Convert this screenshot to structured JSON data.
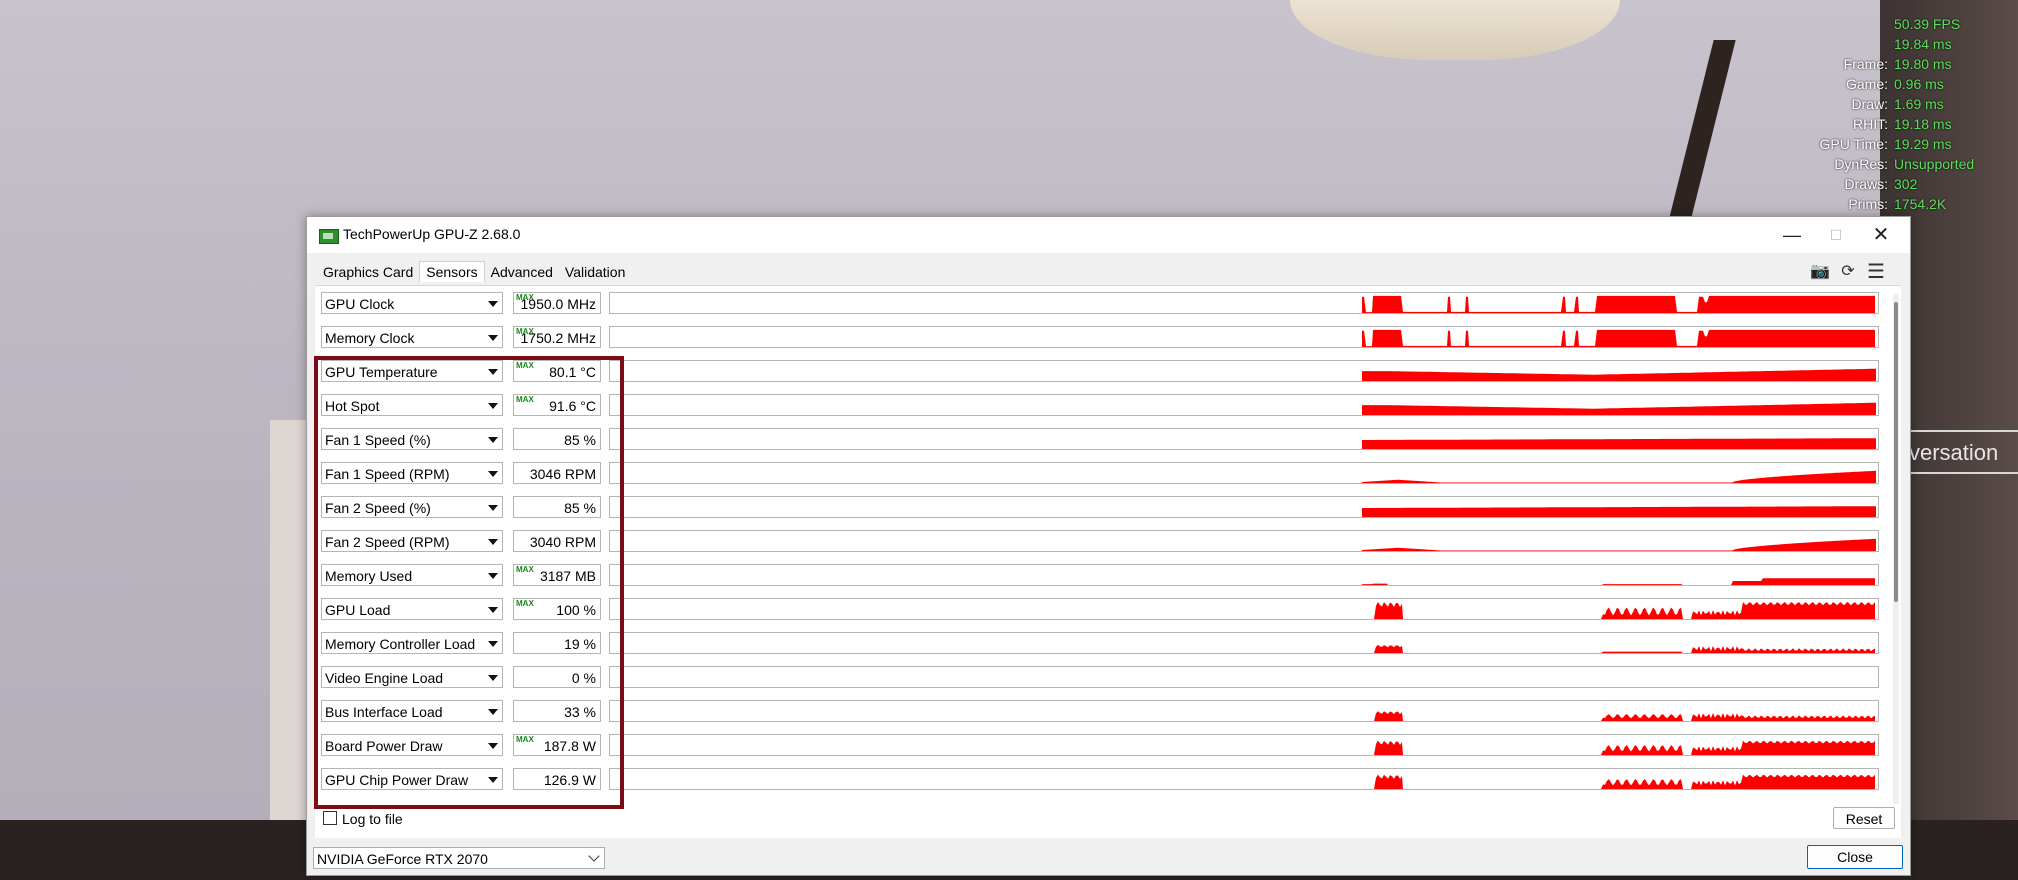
{
  "overlay_stats": [
    {
      "label": "",
      "value": "50.39 FPS"
    },
    {
      "label": "",
      "value": "19.84 ms"
    },
    {
      "label": "Frame:",
      "value": "19.80 ms"
    },
    {
      "label": "Game:",
      "value": "0.96 ms"
    },
    {
      "label": "Draw:",
      "value": "1.69 ms"
    },
    {
      "label": "RHIT:",
      "value": "19.18 ms"
    },
    {
      "label": "GPU Time:",
      "value": "19.29 ms"
    },
    {
      "label": "DynRes:",
      "value": "Unsupported"
    },
    {
      "label": "Draws:",
      "value": "302"
    },
    {
      "label": "Prims:",
      "value": "1754.2K"
    }
  ],
  "background": {
    "partial_text": "versation"
  },
  "window": {
    "title": "TechPowerUp GPU-Z 2.68.0",
    "tabs": [
      "Graphics Card",
      "Sensors",
      "Advanced",
      "Validation"
    ],
    "active_tab": "Sensors",
    "sensors": [
      {
        "name": "GPU Clock",
        "value": "1950.0 MHz",
        "max": true,
        "graph": "clock"
      },
      {
        "name": "Memory Clock",
        "value": "1750.2 MHz",
        "max": true,
        "graph": "clock"
      },
      {
        "name": "GPU Temperature",
        "value": "80.1 °C",
        "max": true,
        "graph": "temp"
      },
      {
        "name": "Hot Spot",
        "value": "91.6 °C",
        "max": true,
        "graph": "temp"
      },
      {
        "name": "Fan 1 Speed (%)",
        "value": "85 %",
        "max": false,
        "graph": "fanpct"
      },
      {
        "name": "Fan 1 Speed (RPM)",
        "value": "3046 RPM",
        "max": false,
        "graph": "fanrpm"
      },
      {
        "name": "Fan 2 Speed (%)",
        "value": "85 %",
        "max": false,
        "graph": "fanpct"
      },
      {
        "name": "Fan 2 Speed (RPM)",
        "value": "3040 RPM",
        "max": false,
        "graph": "fanrpm"
      },
      {
        "name": "Memory Used",
        "value": "3187 MB",
        "max": true,
        "graph": "mem"
      },
      {
        "name": "GPU Load",
        "value": "100 %",
        "max": true,
        "graph": "load"
      },
      {
        "name": "Memory Controller Load",
        "value": "19 %",
        "max": false,
        "graph": "mcload"
      },
      {
        "name": "Video Engine Load",
        "value": "0 %",
        "max": false,
        "graph": "none"
      },
      {
        "name": "Bus Interface Load",
        "value": "33 %",
        "max": false,
        "graph": "bus"
      },
      {
        "name": "Board Power Draw",
        "value": "187.8 W",
        "max": true,
        "graph": "power"
      },
      {
        "name": "GPU Chip Power Draw",
        "value": "126.9 W",
        "max": false,
        "graph": "power"
      }
    ],
    "max_badge": "MAX",
    "log_to_file_label": "Log to file",
    "reset_label": "Reset",
    "gpu_selected": "NVIDIA GeForce RTX 2070",
    "close_label": "Close",
    "graph_color": "#ff0000",
    "highlight_color": "#7b0c16"
  }
}
